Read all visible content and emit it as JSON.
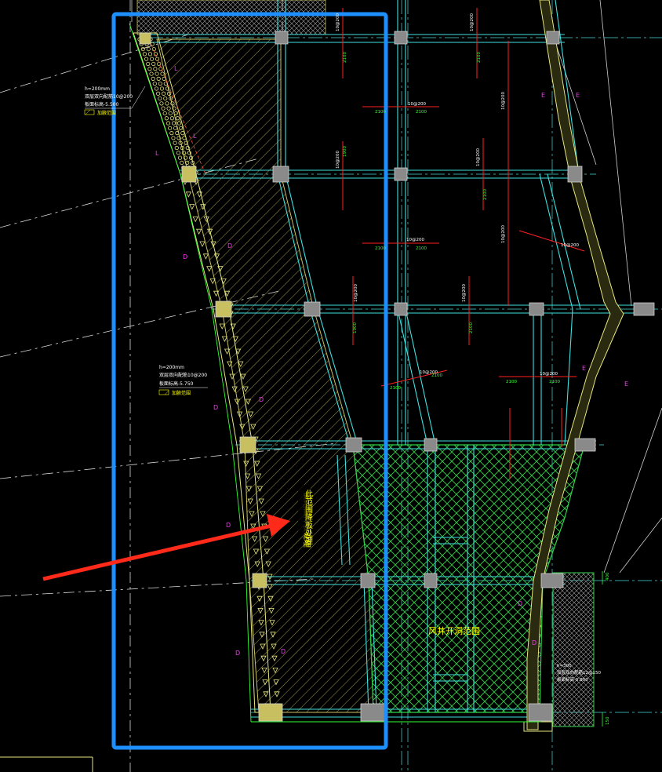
{
  "colors": {
    "background": "#000000",
    "selection_box": "#1e8fff",
    "arrow": "#ff2a1a",
    "grid_lines": "#4ad8d8",
    "beam_cyan": "#3fe0e0",
    "hatch_yellow": "#c8c060",
    "hatch_green": "#2fd24a",
    "rebar_red": "#ff2020",
    "dim_green": "#33ff33",
    "text_yellow": "#ffff00",
    "text_magenta": "#ff30ff",
    "column_fill": "#8a8a8a",
    "guide_white": "#d8d8d8"
  },
  "notes": {
    "note_top": {
      "line1": "h=200mm",
      "line2": "双层双向配筋10@200",
      "line3": "板面标高-5.500",
      "line4": "加腋范围"
    },
    "note_mid": {
      "line1": "h=200mm",
      "line2": "双层双向配筋10@200",
      "line3": "板面标高-5.750",
      "line4": "加腋范围"
    },
    "note_right": {
      "line1": "h=300",
      "line2": "双层双向配筋12@150",
      "line3": "板面标高-5.800"
    },
    "vertical_label": "此范围降板处理",
    "center_label": "风井开洞范围"
  },
  "rebar_labels": {
    "b1": "10@200",
    "b2": "10@200",
    "b3": "10@200",
    "b4": "10@200",
    "b5": "10@200",
    "b6": "10@200",
    "b7": "10@200",
    "b8": "10@200",
    "b9": "10@200",
    "b10": "10@200",
    "b11": "10@200",
    "b12": "10@200",
    "b13": "10@200"
  },
  "dims": {
    "d2100": "2100",
    "d1900": "1900",
    "d400": "400",
    "d150": "150"
  },
  "marks": {
    "L": "L",
    "D": "D",
    "E": "E"
  }
}
